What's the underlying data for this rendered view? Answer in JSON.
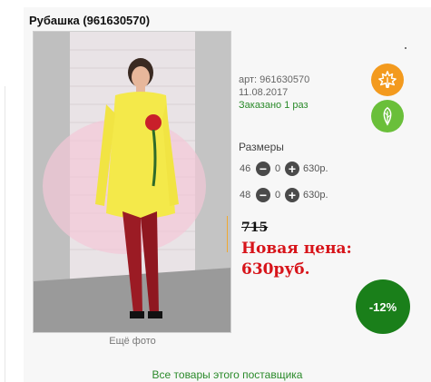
{
  "product": {
    "title": "Рубашка (961630570)",
    "article": "арт: 961630570",
    "date": "11.08.2017",
    "ordered": "Заказано 1 раз"
  },
  "photo": {
    "more_label": "Ещё фото"
  },
  "sizes": {
    "label": "Размеры",
    "rows": [
      {
        "size": "46",
        "qty": "0",
        "price": "630р."
      },
      {
        "size": "48",
        "qty": "0",
        "price": "630р."
      }
    ]
  },
  "pricing": {
    "old_price": "715",
    "new_price_label": "Новая цена:",
    "new_price_value": "630руб.",
    "discount": "-12%"
  },
  "badges": {
    "orange_icon": "maple-leaf-icon",
    "green_icon": "leaf-icon",
    "orange_color": "#f39a1e",
    "green_color": "#6abf3a"
  },
  "footer": {
    "supplier_link": "Все товары этого поставщика"
  }
}
